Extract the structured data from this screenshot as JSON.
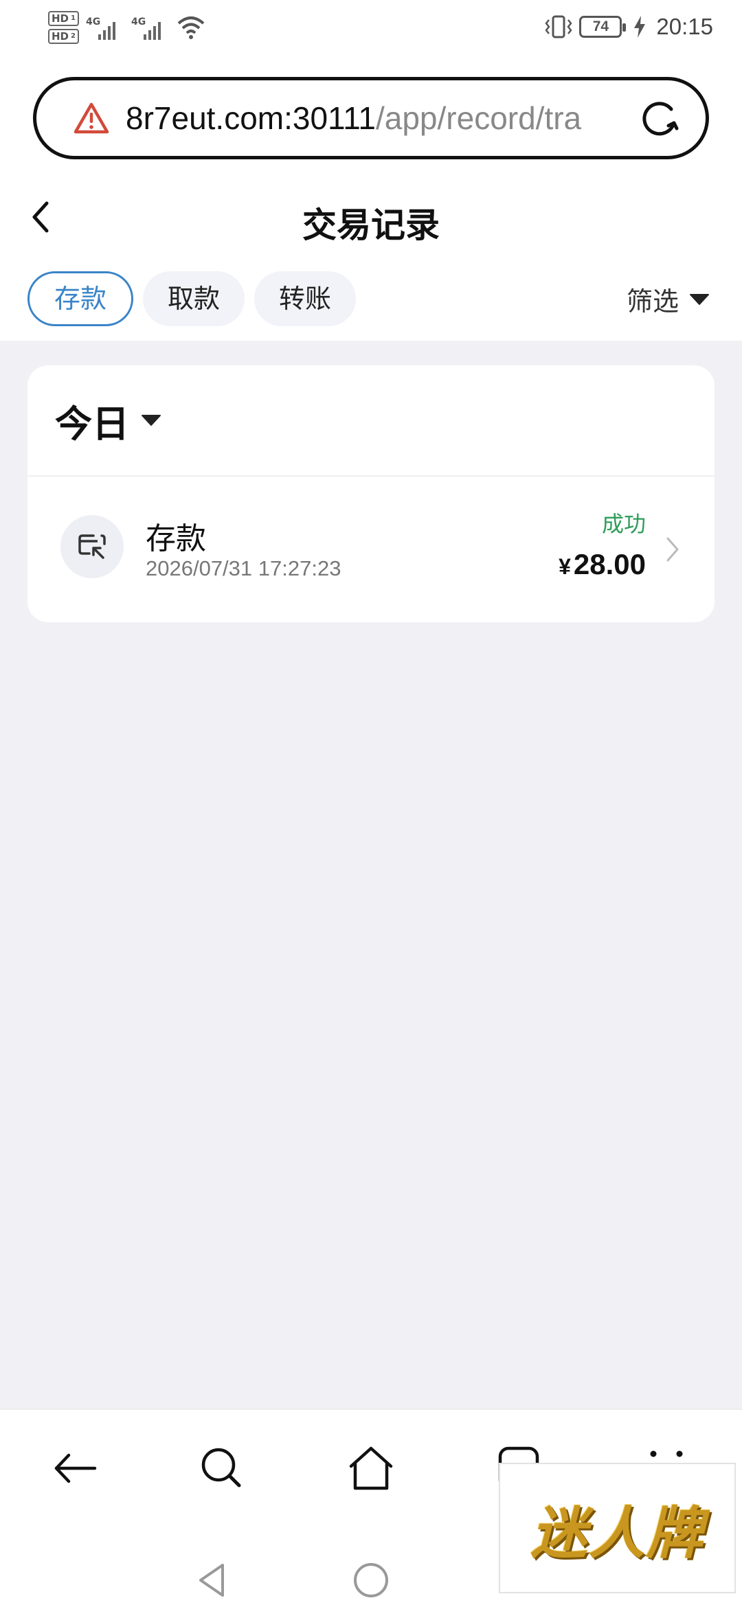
{
  "status_bar": {
    "sim1": "HD",
    "sim1_index": "1",
    "sim2": "HD",
    "sim2_index": "2",
    "network1": "4G",
    "network2": "4G",
    "battery": "74",
    "time": "20:15"
  },
  "url_bar": {
    "domain": "8r7eut.com:30111",
    "path": "/app/record/tra",
    "warning_icon": "warning-triangle-icon",
    "reload_icon": "reload-icon"
  },
  "header": {
    "title": "交易记录"
  },
  "tabs": [
    {
      "label": "存款",
      "active": true
    },
    {
      "label": "取款",
      "active": false
    },
    {
      "label": "转账",
      "active": false
    }
  ],
  "filter": {
    "label": "筛选"
  },
  "group": {
    "title": "今日",
    "records": [
      {
        "title": "存款",
        "time": "2026/07/31 17:27:23",
        "status": "成功",
        "currency": "¥",
        "amount": "28.00"
      }
    ]
  },
  "watermark": {
    "text": "迷人牌"
  },
  "colors": {
    "accent": "#3a84c8",
    "success": "#2f9e5b",
    "background": "#f1f1f5"
  }
}
